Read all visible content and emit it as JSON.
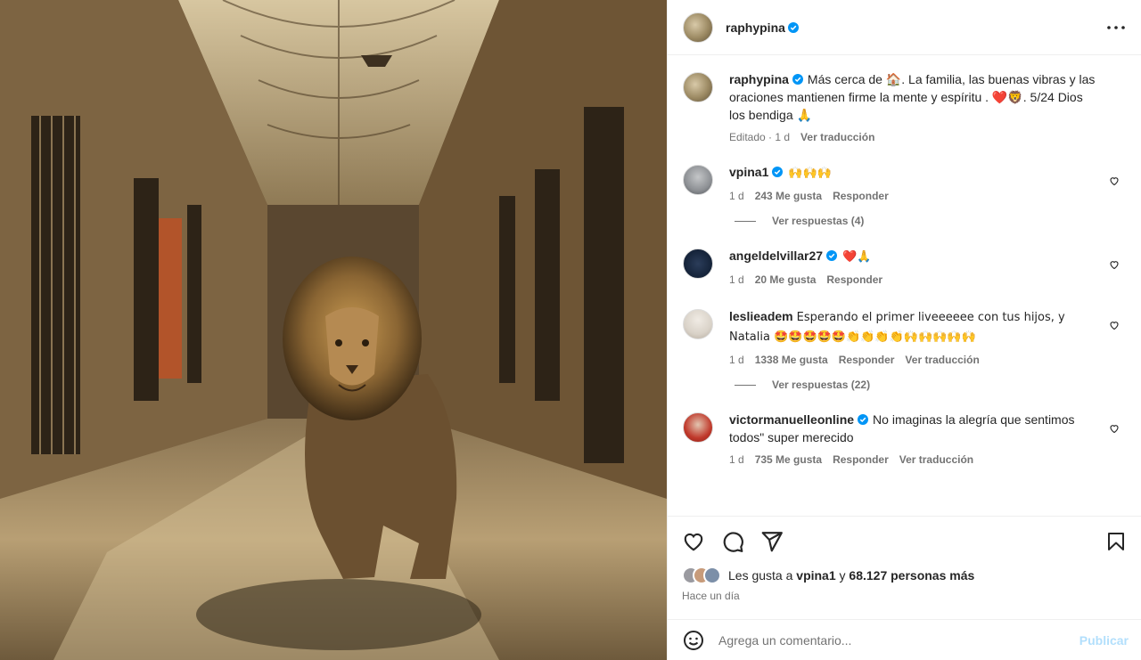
{
  "header": {
    "username": "raphypina"
  },
  "caption": {
    "username": "raphypina",
    "text": "Más cerca de 🏠. La familia, las buenas vibras y las oraciones mantienen firme la mente y espíritu . ❤️🦁. 5/24 Dios los bendiga 🙏",
    "edited": "Editado · 1 d",
    "translate": "Ver traducción"
  },
  "comments": [
    {
      "username": "vpina1",
      "text": "🙌🙌🙌",
      "age": "1 d",
      "likes": "243 Me gusta",
      "reply": "Responder",
      "translate": "",
      "replies": "Ver respuestas (4)"
    },
    {
      "username": "angeldelvillar27",
      "text": "❤️🙏",
      "age": "1 d",
      "likes": "20 Me gusta",
      "reply": "Responder",
      "translate": "",
      "replies": ""
    },
    {
      "username": "leslieadem",
      "text": "Esperando el primer liveeeeee con tus hijos, y Natalia 🤩🤩🤩🤩🤩👏👏👏👏🙌🙌🙌🙌🙌",
      "age": "1 d",
      "likes": "1338 Me gusta",
      "reply": "Responder",
      "translate": "Ver traducción",
      "replies": "Ver respuestas (22)"
    },
    {
      "username": "victormanuelleonline",
      "text": "No imaginas la alegría que sentimos todos\" super merecido",
      "age": "1 d",
      "likes": "735 Me gusta",
      "reply": "Responder",
      "translate": "Ver traducción",
      "replies": ""
    }
  ],
  "likes": {
    "prefix": "Les gusta a",
    "user": "vpina1",
    "connector": "y",
    "count": "68.127 personas más"
  },
  "date": "Hace un día",
  "composer": {
    "placeholder": "Agrega un comentario...",
    "publish": "Publicar"
  },
  "colors": {
    "verified": "#0095f6",
    "text": "#262626",
    "muted": "#737373",
    "publish": "#b2dffc"
  },
  "icons": [
    "more-icon",
    "like-icon",
    "comment-icon",
    "share-icon",
    "save-icon",
    "emoji-icon",
    "verified-icon",
    "heart-small-icon"
  ]
}
